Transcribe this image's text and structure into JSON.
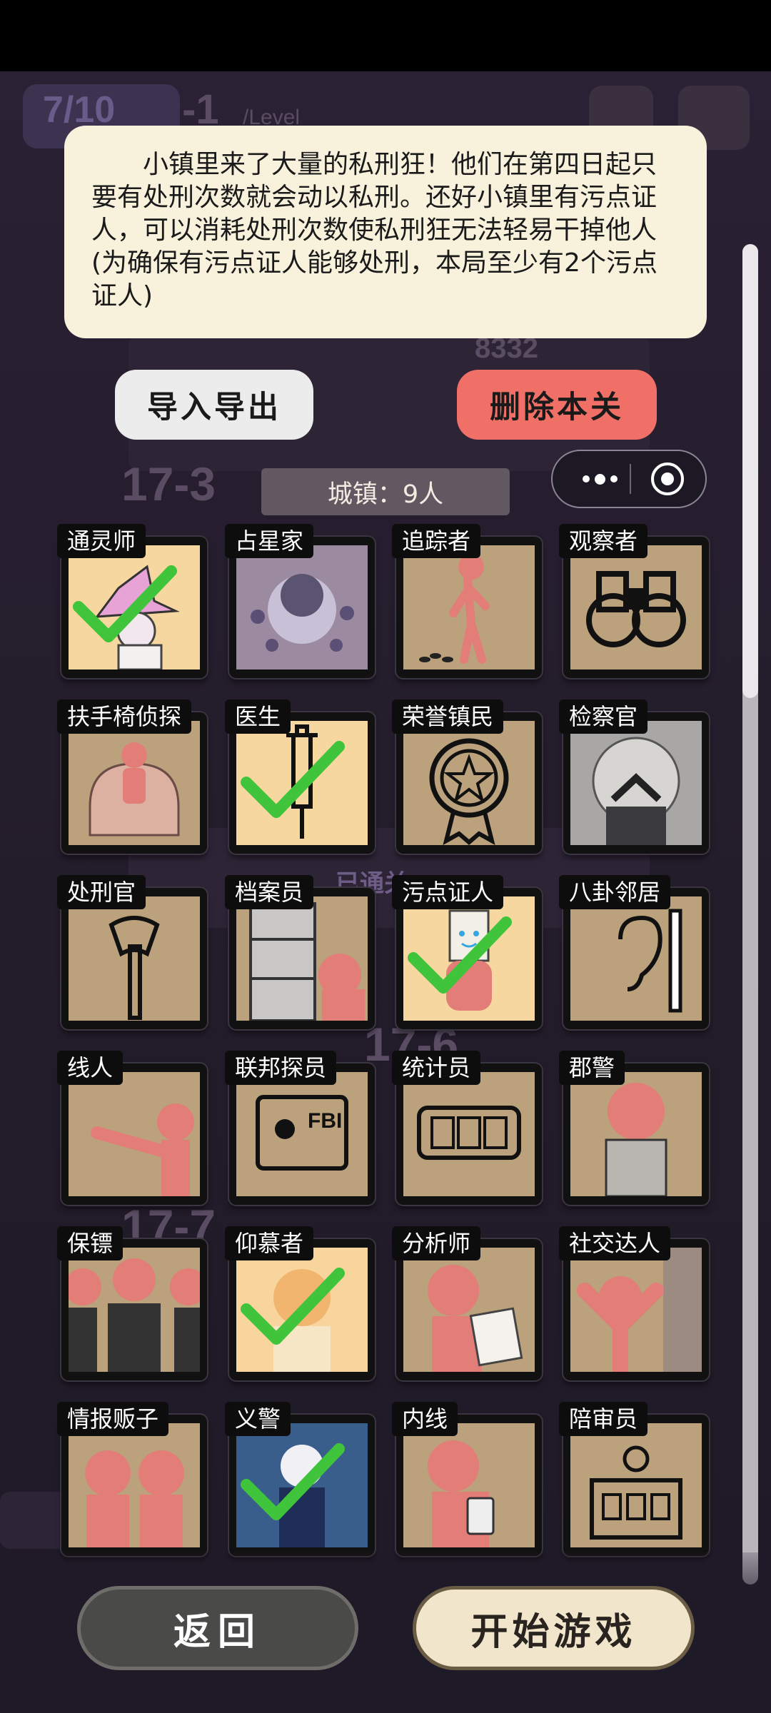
{
  "tooltip": {
    "text": "小镇里来了大量的私刑狂！他们在第四日起只要有处刑次数就会动以私刑。还好小镇里有污点证人，可以消耗处刑次数使私刑狂无法轻易干掉他人(为确保有污点证人能够处刑，本局至少有2个污点证人)"
  },
  "actions": {
    "import_export_label": "导入导出",
    "delete_level_label": "删除本关"
  },
  "mini_program_capsule": {
    "more_icon": "more-dots-icon",
    "close_icon": "target-circle-icon"
  },
  "town": {
    "label": "城镇：9人"
  },
  "background": {
    "energy": "7/10",
    "level_a": "-1",
    "score": "8332",
    "level_b": "17-3",
    "level_c": "17-6",
    "level_d": "17-7",
    "cleared_tag": "已通关",
    "level_word": "/Level"
  },
  "roles": [
    {
      "name": "通灵师",
      "icon": "witch-hat-icon",
      "selected": true
    },
    {
      "name": "占星家",
      "icon": "astrologer-portrait-icon",
      "selected": false
    },
    {
      "name": "追踪者",
      "icon": "footprints-icon",
      "selected": false
    },
    {
      "name": "观察者",
      "icon": "binoculars-icon",
      "selected": false
    },
    {
      "name": "扶手椅侦探",
      "icon": "armchair-icon",
      "selected": false
    },
    {
      "name": "医生",
      "icon": "syringe-icon",
      "selected": true
    },
    {
      "name": "荣誉镇民",
      "icon": "medal-icon",
      "selected": false
    },
    {
      "name": "检察官",
      "icon": "prosecutor-portrait-icon",
      "selected": false
    },
    {
      "name": "处刑官",
      "icon": "axe-icon",
      "selected": false
    },
    {
      "name": "档案员",
      "icon": "bookshelf-icon",
      "selected": false
    },
    {
      "name": "污点证人",
      "icon": "bag-head-icon",
      "selected": true
    },
    {
      "name": "八卦邻居",
      "icon": "ear-wall-icon",
      "selected": false
    },
    {
      "name": "线人",
      "icon": "pointing-figure-icon",
      "selected": false
    },
    {
      "name": "联邦探员",
      "icon": "fbi-badge-icon",
      "selected": false
    },
    {
      "name": "统计员",
      "icon": "counter-icon",
      "selected": false
    },
    {
      "name": "郡警",
      "icon": "sheriff-icon",
      "selected": false
    },
    {
      "name": "保镖",
      "icon": "bodyguards-icon",
      "selected": false
    },
    {
      "name": "仰慕者",
      "icon": "admirer-portrait-icon",
      "selected": true
    },
    {
      "name": "分析师",
      "icon": "analyst-papers-icon",
      "selected": false
    },
    {
      "name": "社交达人",
      "icon": "waving-figure-icon",
      "selected": false
    },
    {
      "name": "情报贩子",
      "icon": "whispering-figures-icon",
      "selected": false
    },
    {
      "name": "义警",
      "icon": "vigilante-portrait-icon",
      "selected": true
    },
    {
      "name": "内线",
      "icon": "insider-phone-icon",
      "selected": false
    },
    {
      "name": "陪审员",
      "icon": "jury-box-icon",
      "selected": false
    }
  ],
  "bottom": {
    "back_label": "返回",
    "start_label": "开始游戏"
  },
  "colors": {
    "card_bg": "#bba27c",
    "card_selected_bg": "#f6d7a0",
    "check": "#3fc43b",
    "figure": "#e27d78",
    "delete_button": "#f07068"
  }
}
